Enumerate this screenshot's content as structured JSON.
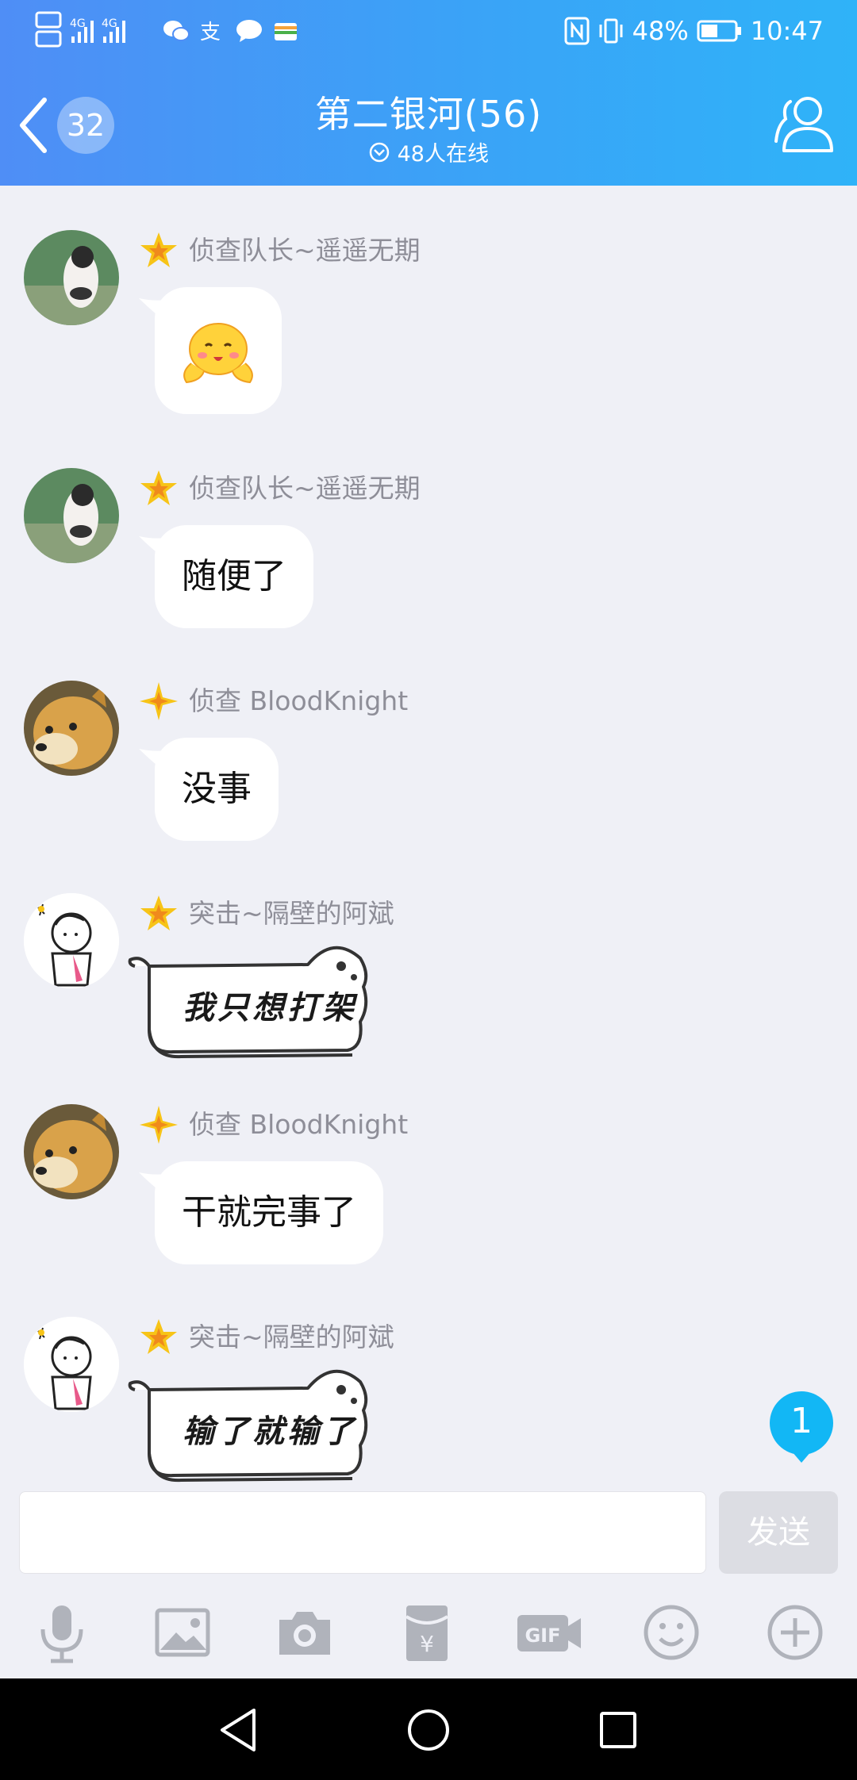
{
  "status_bar": {
    "signal_left": "HD 4G 4G",
    "battery": "48%",
    "time": "10:47"
  },
  "header": {
    "unread_count": "32",
    "title": "第二银河(56)",
    "online": "48人在线"
  },
  "messages": [
    {
      "sender": "侦查队长~遥遥无期",
      "type": "emoji",
      "avatar": "cat-avatar"
    },
    {
      "sender": "侦查队长~遥遥无期",
      "type": "text",
      "text": "随便了",
      "avatar": "cat-avatar"
    },
    {
      "sender": "侦查 BloodKnight",
      "type": "text",
      "text": "没事",
      "avatar": "doge-avatar"
    },
    {
      "sender": "突击~隔壁的阿斌",
      "type": "sticker",
      "text": "我只想打架",
      "avatar": "sketch-avatar"
    },
    {
      "sender": "侦查 BloodKnight",
      "type": "text",
      "text": "干就完事了",
      "avatar": "doge-avatar"
    },
    {
      "sender": "突击~隔壁的阿斌",
      "type": "sticker",
      "text": "输了就输了",
      "avatar": "sketch-avatar"
    }
  ],
  "new_messages_badge": "1",
  "input": {
    "value": "",
    "send_label": "发送"
  },
  "toolbar": [
    "microphone-icon",
    "image-icon",
    "camera-icon",
    "red-packet-icon",
    "gif-icon",
    "emoji-icon",
    "plus-icon"
  ],
  "colors": {
    "header_gradient_start": "#4f8ef6",
    "header_gradient_end": "#2fb3f8",
    "background": "#eff0f6",
    "badge_blue": "#12b7f5",
    "star_gold": "#f7c417"
  }
}
